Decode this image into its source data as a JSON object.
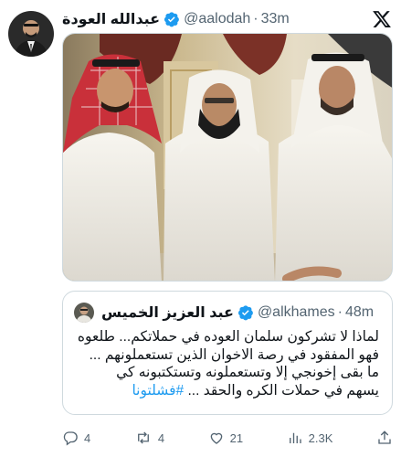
{
  "tweet": {
    "author_name": "عبدالله العودة",
    "handle": "@aalodah",
    "separator": "·",
    "time": "33m",
    "verified_icon": "verified-badge-icon",
    "brand_icon": "x-logo-icon",
    "image": "photo of three men in white thobes and headdresses in an ornate room"
  },
  "quote": {
    "author_name": "عبد العزيز الخميس",
    "handle": "@alkhames",
    "separator": "·",
    "time": "48m",
    "lines": [
      "لماذا لا تشركون سلمان العوده في حملاتكم... طلعوه",
      "فهو المفقود في رصة الاخوان الذين تستعملونهم ...",
      "ما بقى إخونجي إلا وتستعملونه وتستكتبونه كي",
      "يسهم في حملات الكره والحقد ..."
    ],
    "hashtag": "#فشلتونا"
  },
  "actions": {
    "replies": "4",
    "reposts": "4",
    "likes": "21",
    "views": "2.3K"
  },
  "colors": {
    "accent": "#1d9bf0",
    "muted": "#536471",
    "text": "#0f1419",
    "border": "#cfd9de"
  }
}
